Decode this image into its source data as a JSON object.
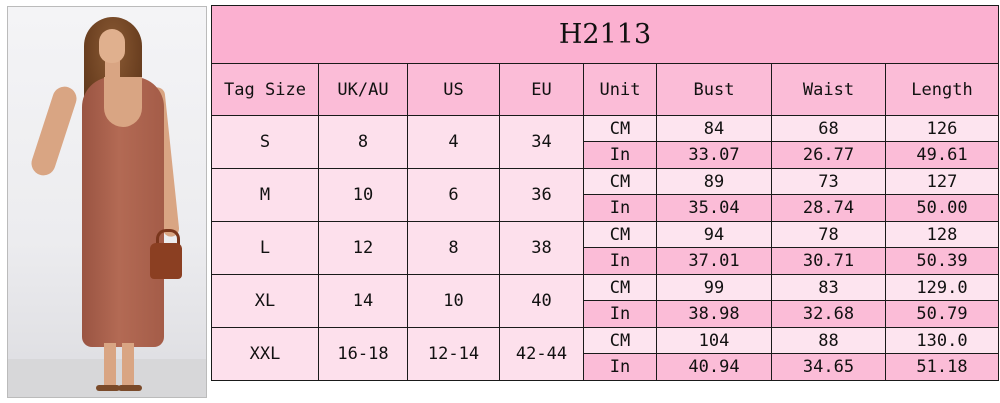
{
  "photo": {
    "alt": "Model wearing ribbed rust midi tank dress with brown handbag"
  },
  "table": {
    "title": "H2113",
    "headers": [
      "Tag Size",
      "UK/AU",
      "US",
      "EU",
      "Unit",
      "Bust",
      "Waist",
      "Length"
    ],
    "rows": [
      {
        "tag": "S",
        "uk": "8",
        "us": "4",
        "eu": "34",
        "cm": {
          "unit": "CM",
          "bust": "84",
          "waist": "68",
          "length": "126"
        },
        "in": {
          "unit": "In",
          "bust": "33.07",
          "waist": "26.77",
          "length": "49.61"
        }
      },
      {
        "tag": "M",
        "uk": "10",
        "us": "6",
        "eu": "36",
        "cm": {
          "unit": "CM",
          "bust": "89",
          "waist": "73",
          "length": "127"
        },
        "in": {
          "unit": "In",
          "bust": "35.04",
          "waist": "28.74",
          "length": "50.00"
        }
      },
      {
        "tag": "L",
        "uk": "12",
        "us": "8",
        "eu": "38",
        "cm": {
          "unit": "CM",
          "bust": "94",
          "waist": "78",
          "length": "128"
        },
        "in": {
          "unit": "In",
          "bust": "37.01",
          "waist": "30.71",
          "length": "50.39"
        }
      },
      {
        "tag": "XL",
        "uk": "14",
        "us": "10",
        "eu": "40",
        "cm": {
          "unit": "CM",
          "bust": "99",
          "waist": "83",
          "length": "129.0"
        },
        "in": {
          "unit": "In",
          "bust": "38.98",
          "waist": "32.68",
          "length": "50.79"
        }
      },
      {
        "tag": "XXL",
        "uk": "16-18",
        "us": "12-14",
        "eu": "42-44",
        "cm": {
          "unit": "CM",
          "bust": "104",
          "waist": "88",
          "length": "130.0"
        },
        "in": {
          "unit": "In",
          "bust": "40.94",
          "waist": "34.65",
          "length": "51.18"
        }
      }
    ]
  },
  "colors": {
    "title_bg": "#fbb0d0",
    "header_bg": "#fbbcd7",
    "cell_light": "#fde0ec",
    "cell_in": "#fbbcd7"
  }
}
